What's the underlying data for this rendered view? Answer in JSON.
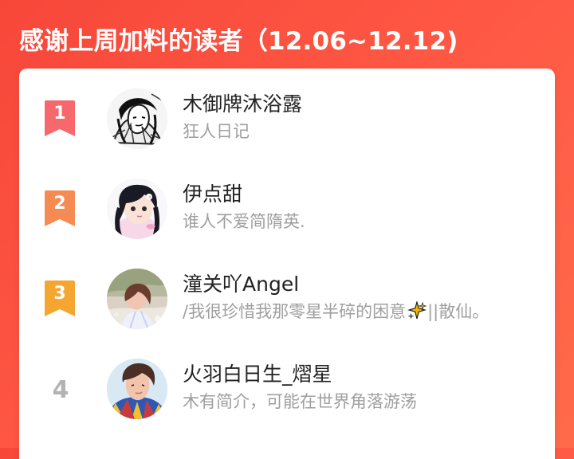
{
  "header": {
    "title": "感谢上周加料的读者（12.06~12.12)"
  },
  "colors": {
    "background_start": "#f7473a",
    "background_end": "#ff6b4a",
    "card_background": "#ffffff",
    "rank_1_badge": "#f6686b",
    "rank_2_badge": "#f58b52",
    "rank_3_badge": "#f4a631",
    "rank_plain": "#b3b3b3",
    "username_text": "#222222",
    "bio_text": "#9f9f9f"
  },
  "readers": [
    {
      "rank": "1",
      "name": "木御牌沐浴露",
      "bio": "狂人日记",
      "badge_icon": "bookmark-badge-icon",
      "avatar": "monochrome-manga-avatar"
    },
    {
      "rank": "2",
      "name": "伊点甜",
      "bio": "谁人不爱简隋英.",
      "badge_icon": "bookmark-badge-icon",
      "avatar": "anime-girl-avatar"
    },
    {
      "rank": "3",
      "name": "潼关吖Angel",
      "bio_prefix": "/我很珍惜我那零星半碎的困意",
      "bio_suffix": "||散仙。",
      "badge_icon": "bookmark-badge-icon",
      "bio_icon": "sparkles-icon",
      "avatar": "girl-outdoors-avatar"
    },
    {
      "rank": "4",
      "name": "火羽白日生_熠星",
      "bio": "木有简介，可能在世界角落游荡",
      "avatar": "boy-portrait-avatar"
    }
  ]
}
